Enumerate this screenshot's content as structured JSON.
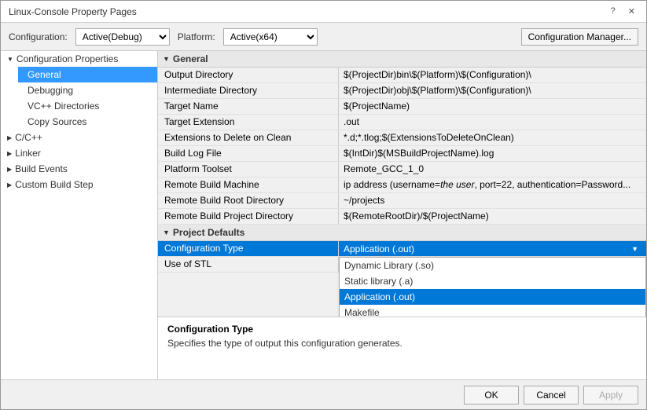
{
  "window": {
    "title": "Linux-Console Property Pages",
    "close_icon": "✕",
    "help_icon": "?"
  },
  "toolbar": {
    "config_label": "Configuration:",
    "config_value": "Active(Debug)",
    "platform_label": "Platform:",
    "platform_value": "Active(x64)",
    "config_manager_label": "Configuration Manager..."
  },
  "sidebar": {
    "root_item": "Configuration Properties",
    "items": [
      {
        "id": "general",
        "label": "General",
        "level": 1,
        "active": true
      },
      {
        "id": "debugging",
        "label": "Debugging",
        "level": 1
      },
      {
        "id": "vc-dirs",
        "label": "VC++ Directories",
        "level": 1
      },
      {
        "id": "copy-sources",
        "label": "Copy Sources",
        "level": 1
      },
      {
        "id": "c-cpp",
        "label": "C/C++",
        "level": 0,
        "expandable": true
      },
      {
        "id": "linker",
        "label": "Linker",
        "level": 0,
        "expandable": true
      },
      {
        "id": "build-events",
        "label": "Build Events",
        "level": 0,
        "expandable": true
      },
      {
        "id": "custom-build",
        "label": "Custom Build Step",
        "level": 0,
        "expandable": true
      }
    ]
  },
  "section_general": {
    "label": "General",
    "properties": [
      {
        "name": "Output Directory",
        "value": "$(ProjectDir)bin\\$(Platform)\\$(Configuration)\\"
      },
      {
        "name": "Intermediate Directory",
        "value": "$(ProjectDir)obj\\$(Platform)\\$(Configuration)\\"
      },
      {
        "name": "Target Name",
        "value": "$(ProjectName)"
      },
      {
        "name": "Target Extension",
        "value": ".out"
      },
      {
        "name": "Extensions to Delete on Clean",
        "value": "*.d;*.tlog;$(ExtensionsToDeleteOnClean)"
      },
      {
        "name": "Build Log File",
        "value": "$(IntDir)$(MSBuildProjectName).log"
      },
      {
        "name": "Platform Toolset",
        "value": "Remote_GCC_1_0"
      },
      {
        "name": "Remote Build Machine",
        "value": "ip address   (username=the user, port=22, authentication=Password..."
      },
      {
        "name": "Remote Build Root Directory",
        "value": "~/projects"
      },
      {
        "name": "Remote Build Project Directory",
        "value": "$(RemoteRootDir)/$(ProjectName)"
      }
    ]
  },
  "section_project_defaults": {
    "label": "Project Defaults",
    "properties": [
      {
        "name": "Configuration Type",
        "value": "Application (.out)",
        "selected": true,
        "has_dropdown": true
      },
      {
        "name": "Use of STL",
        "value": ""
      }
    ],
    "dropdown_items": [
      {
        "label": "Dynamic Library (.so)",
        "selected": false
      },
      {
        "label": "Static library (.a)",
        "selected": false
      },
      {
        "label": "Application (.out)",
        "selected": true
      },
      {
        "label": "Makefile",
        "selected": false
      }
    ]
  },
  "description": {
    "title": "Configuration Type",
    "text": "Specifies the type of output this configuration generates."
  },
  "buttons": {
    "ok": "OK",
    "cancel": "Cancel",
    "apply": "Apply"
  },
  "colors": {
    "selected_bg": "#0078d7",
    "dropdown_selected_bg": "#0078d7",
    "header_bg": "#e8e8e8"
  }
}
